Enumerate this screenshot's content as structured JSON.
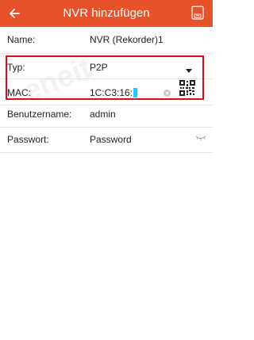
{
  "header": {
    "title": "NVR hinzufügen"
  },
  "form": {
    "name": {
      "label": "Name:",
      "value": "NVR (Rekorder)1"
    },
    "typ": {
      "label": "Typ:",
      "value": "P2P"
    },
    "mac": {
      "label": "MAC:",
      "value": "1C:C3:16:"
    },
    "benutzername": {
      "label": "Benutzername:",
      "value": "admin"
    },
    "passwort": {
      "label": "Passwort:",
      "placeholder": "Password"
    }
  },
  "watermark": {
    "text": "eneit"
  },
  "colors": {
    "header_bg": "#e8522b",
    "highlight_border": "#e10a17",
    "placeholder": "#f3c9b7",
    "cursor": "#2ec5ff"
  },
  "icons": [
    "back-arrow-icon",
    "save-icon",
    "dropdown-arrow-icon",
    "clear-icon",
    "qr-code-icon",
    "hide-password-icon"
  ]
}
